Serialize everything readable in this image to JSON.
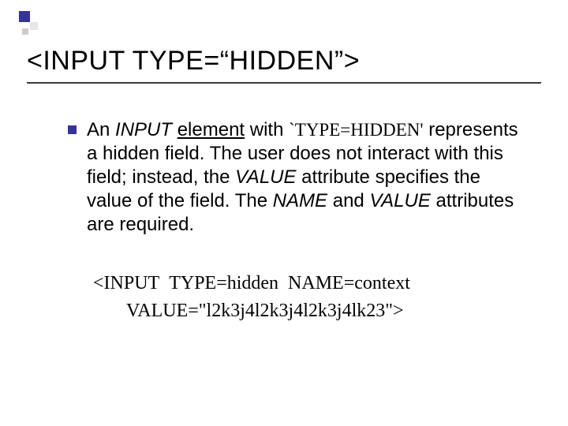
{
  "title": "<INPUT TYPE=“HIDDEN”>",
  "para": {
    "p1a": "An ",
    "p1b": "INPUT",
    "p1c": " ",
    "p1d": "element",
    "p1e": " with ",
    "p1f": "`TYPE=HIDDEN'",
    "p2": "represents a hidden field. The user does not interact with this field; instead, the ",
    "p2b": "VALUE",
    "p3": " attribute specifies the value of the field. The ",
    "p3b": "NAME",
    "p3c": " and ",
    "p3d": "VALUE",
    "p3e": " attributes are required."
  },
  "code": {
    "l1": "<INPUT  TYPE=hidden  NAME=context",
    "l2": "VALUE=\"l2k3j4l2k3j4l2k3j4lk23\">"
  }
}
